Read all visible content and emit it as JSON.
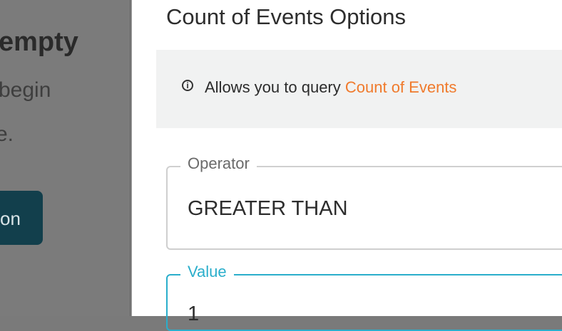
{
  "background_page": {
    "title_fragment": "empty",
    "text_line1_fragment": "begin",
    "text_line2_fragment": "e.",
    "button_fragment": "on"
  },
  "drawer": {
    "title": "Count of Events Options",
    "info": {
      "icon": "info-circle-icon",
      "text": "Allows you to query ",
      "link_text": "Count of Events"
    },
    "fields": {
      "operator": {
        "label": "Operator",
        "value": "GREATER THAN"
      },
      "value": {
        "label": "Value",
        "value": "1"
      }
    }
  },
  "colors": {
    "link": "#f07a2c",
    "focus": "#2aaecb",
    "button_bg": "#123f4c"
  }
}
